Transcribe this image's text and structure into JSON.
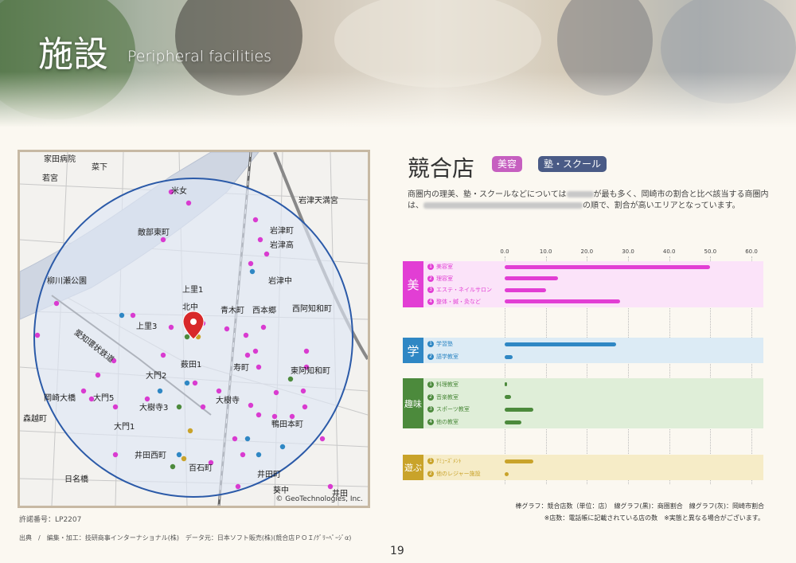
{
  "header": {
    "title": "施設",
    "subtitle": "Peripheral facilities"
  },
  "map": {
    "labels": [
      {
        "text": "家田病院"
      },
      {
        "text": "若宮"
      },
      {
        "text": "菜下"
      },
      {
        "text": "米女"
      },
      {
        "text": "岩津天満宮"
      },
      {
        "text": "敵部東町"
      },
      {
        "text": "岩津町"
      },
      {
        "text": "岩津高"
      },
      {
        "text": "柳川瀬公園"
      },
      {
        "text": "岩津中"
      },
      {
        "text": "上里1"
      },
      {
        "text": "北中"
      },
      {
        "text": "青木町"
      },
      {
        "text": "西本郷"
      },
      {
        "text": "西阿知和町"
      },
      {
        "text": "上里3"
      },
      {
        "text": "愛知環状鉄道"
      },
      {
        "text": "薮田1"
      },
      {
        "text": "寿町"
      },
      {
        "text": "東阿知和町"
      },
      {
        "text": "大門2"
      },
      {
        "text": "大門5"
      },
      {
        "text": "岡崎大橋"
      },
      {
        "text": "大樹寺"
      },
      {
        "text": "大樹寺3"
      },
      {
        "text": "森越町"
      },
      {
        "text": "鴨田本町"
      },
      {
        "text": "大門1"
      },
      {
        "text": "百石町"
      },
      {
        "text": "井田西町"
      },
      {
        "text": "日名橋"
      },
      {
        "text": "井田町"
      },
      {
        "text": "葵中"
      },
      {
        "text": "井田"
      }
    ],
    "copyright": "© GeoTechnologies, Inc.",
    "permit": "許諾番号：LP2207"
  },
  "source": "出典　/　編集・加工：技研商事インターナショナル(株)　データ元：日本ソフト販売(株)(競合店ＰＯＩ/ｸﾞﾘｰﾍﾟｰｼﾞα)",
  "page_number": "19",
  "section": {
    "title": "競合店",
    "tags": [
      {
        "label": "美容",
        "color": "#c65fc0"
      },
      {
        "label": "塾・スクール",
        "color": "#4a5b86"
      }
    ],
    "desc_a": "商圏内の理美、塾・スクールなどについては",
    "desc_b": "が最も多く、岡崎市の割合と比べ該当する商圏内は、",
    "desc_c": "の順で、割合が高いエリアとなっています。"
  },
  "chart_data": {
    "type": "bar",
    "xlim": [
      0,
      60
    ],
    "ticks": [
      "0.0",
      "10.0",
      "20.0",
      "30.0",
      "40.0",
      "50.0",
      "60.0"
    ],
    "groups": [
      {
        "name": "美",
        "color": "#e23ed4",
        "bg": "#fbe3f9",
        "items": [
          {
            "no": "1",
            "label": "美容室",
            "value": 50
          },
          {
            "no": "2",
            "label": "理容室",
            "value": 13
          },
          {
            "no": "3",
            "label": "エステ・ネイルサロン",
            "value": 10
          },
          {
            "no": "4",
            "label": "整体・鍼・灸など",
            "value": 28
          }
        ]
      },
      {
        "name": "学",
        "color": "#2f87c4",
        "bg": "#dcebf5",
        "items": [
          {
            "no": "1",
            "label": "学習塾",
            "value": 27
          },
          {
            "no": "2",
            "label": "語学教室",
            "value": 2
          }
        ]
      },
      {
        "name": "趣味",
        "color": "#4c8a3c",
        "bg": "#dfeed8",
        "items": [
          {
            "no": "1",
            "label": "料理教室",
            "value": 0.5
          },
          {
            "no": "2",
            "label": "音楽教室",
            "value": 1.5
          },
          {
            "no": "3",
            "label": "スポーツ教室",
            "value": 7
          },
          {
            "no": "4",
            "label": "他の教室",
            "value": 4
          }
        ]
      },
      {
        "name": "遊ぶ",
        "color": "#c9a32a",
        "bg": "#f6ecc7",
        "items": [
          {
            "no": "1",
            "label": "ｱﾐｭｰｽﾞﾒﾝﾄ",
            "value": 7
          },
          {
            "no": "2",
            "label": "他のレジャー施設",
            "value": 1
          }
        ]
      }
    ]
  },
  "footnote1": "棒グラフ：競合店数（単位：店）　線グラフ(黒)：商圏割合　線グラフ(灰)：岡崎市割合",
  "footnote2": "※店数：電話帳に記載されている店の数　※実態と異なる場合がございます。",
  "colors": {
    "map_circle": "#2b5aa8",
    "map_fill": "#dfe6f4",
    "pin": "#d8282a",
    "poi_pink": "#d93bd0",
    "poi_blue": "#2f87c4",
    "poi_green": "#4c8a3c",
    "poi_yellow": "#c9a32a"
  }
}
